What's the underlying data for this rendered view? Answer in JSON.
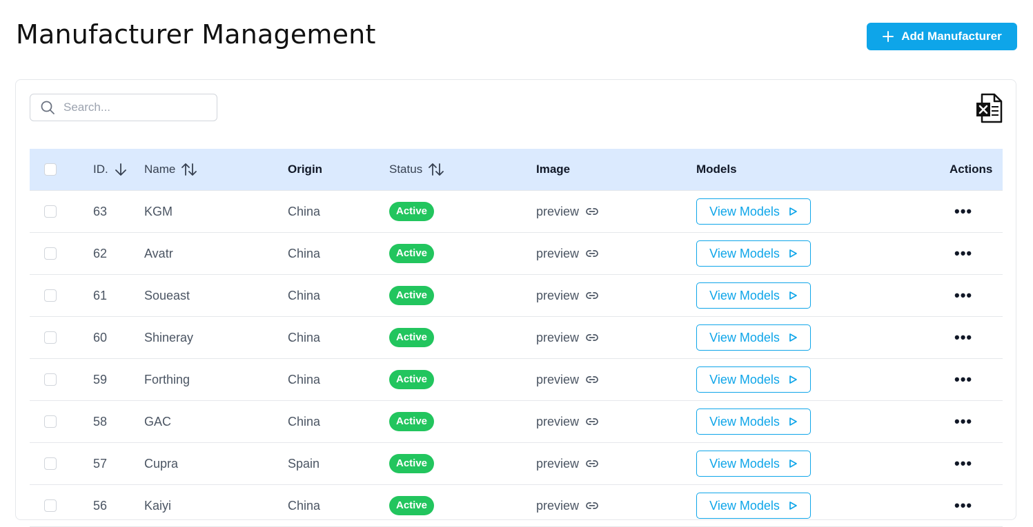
{
  "page": {
    "title": "Manufacturer Management",
    "add_button_label": "Add Manufacturer"
  },
  "search": {
    "placeholder": "Search..."
  },
  "colors": {
    "accent": "#0ea5e9",
    "active_badge": "#22c55e",
    "header_bg": "#dbeafe"
  },
  "table": {
    "columns": {
      "id": "ID.",
      "name": "Name",
      "origin": "Origin",
      "status": "Status",
      "image": "Image",
      "models": "Models",
      "actions": "Actions"
    },
    "rows": [
      {
        "id": "63",
        "name": "KGM",
        "origin": "China",
        "status": "Active",
        "image": "preview",
        "models": "View Models"
      },
      {
        "id": "62",
        "name": "Avatr",
        "origin": "China",
        "status": "Active",
        "image": "preview",
        "models": "View Models"
      },
      {
        "id": "61",
        "name": "Soueast",
        "origin": "China",
        "status": "Active",
        "image": "preview",
        "models": "View Models"
      },
      {
        "id": "60",
        "name": "Shineray",
        "origin": "China",
        "status": "Active",
        "image": "preview",
        "models": "View Models"
      },
      {
        "id": "59",
        "name": "Forthing",
        "origin": "China",
        "status": "Active",
        "image": "preview",
        "models": "View Models"
      },
      {
        "id": "58",
        "name": "GAC",
        "origin": "China",
        "status": "Active",
        "image": "preview",
        "models": "View Models"
      },
      {
        "id": "57",
        "name": "Cupra",
        "origin": "Spain",
        "status": "Active",
        "image": "preview",
        "models": "View Models"
      },
      {
        "id": "56",
        "name": "Kaiyi",
        "origin": "China",
        "status": "Active",
        "image": "preview",
        "models": "View Models"
      }
    ],
    "actions_glyph": "•••"
  }
}
